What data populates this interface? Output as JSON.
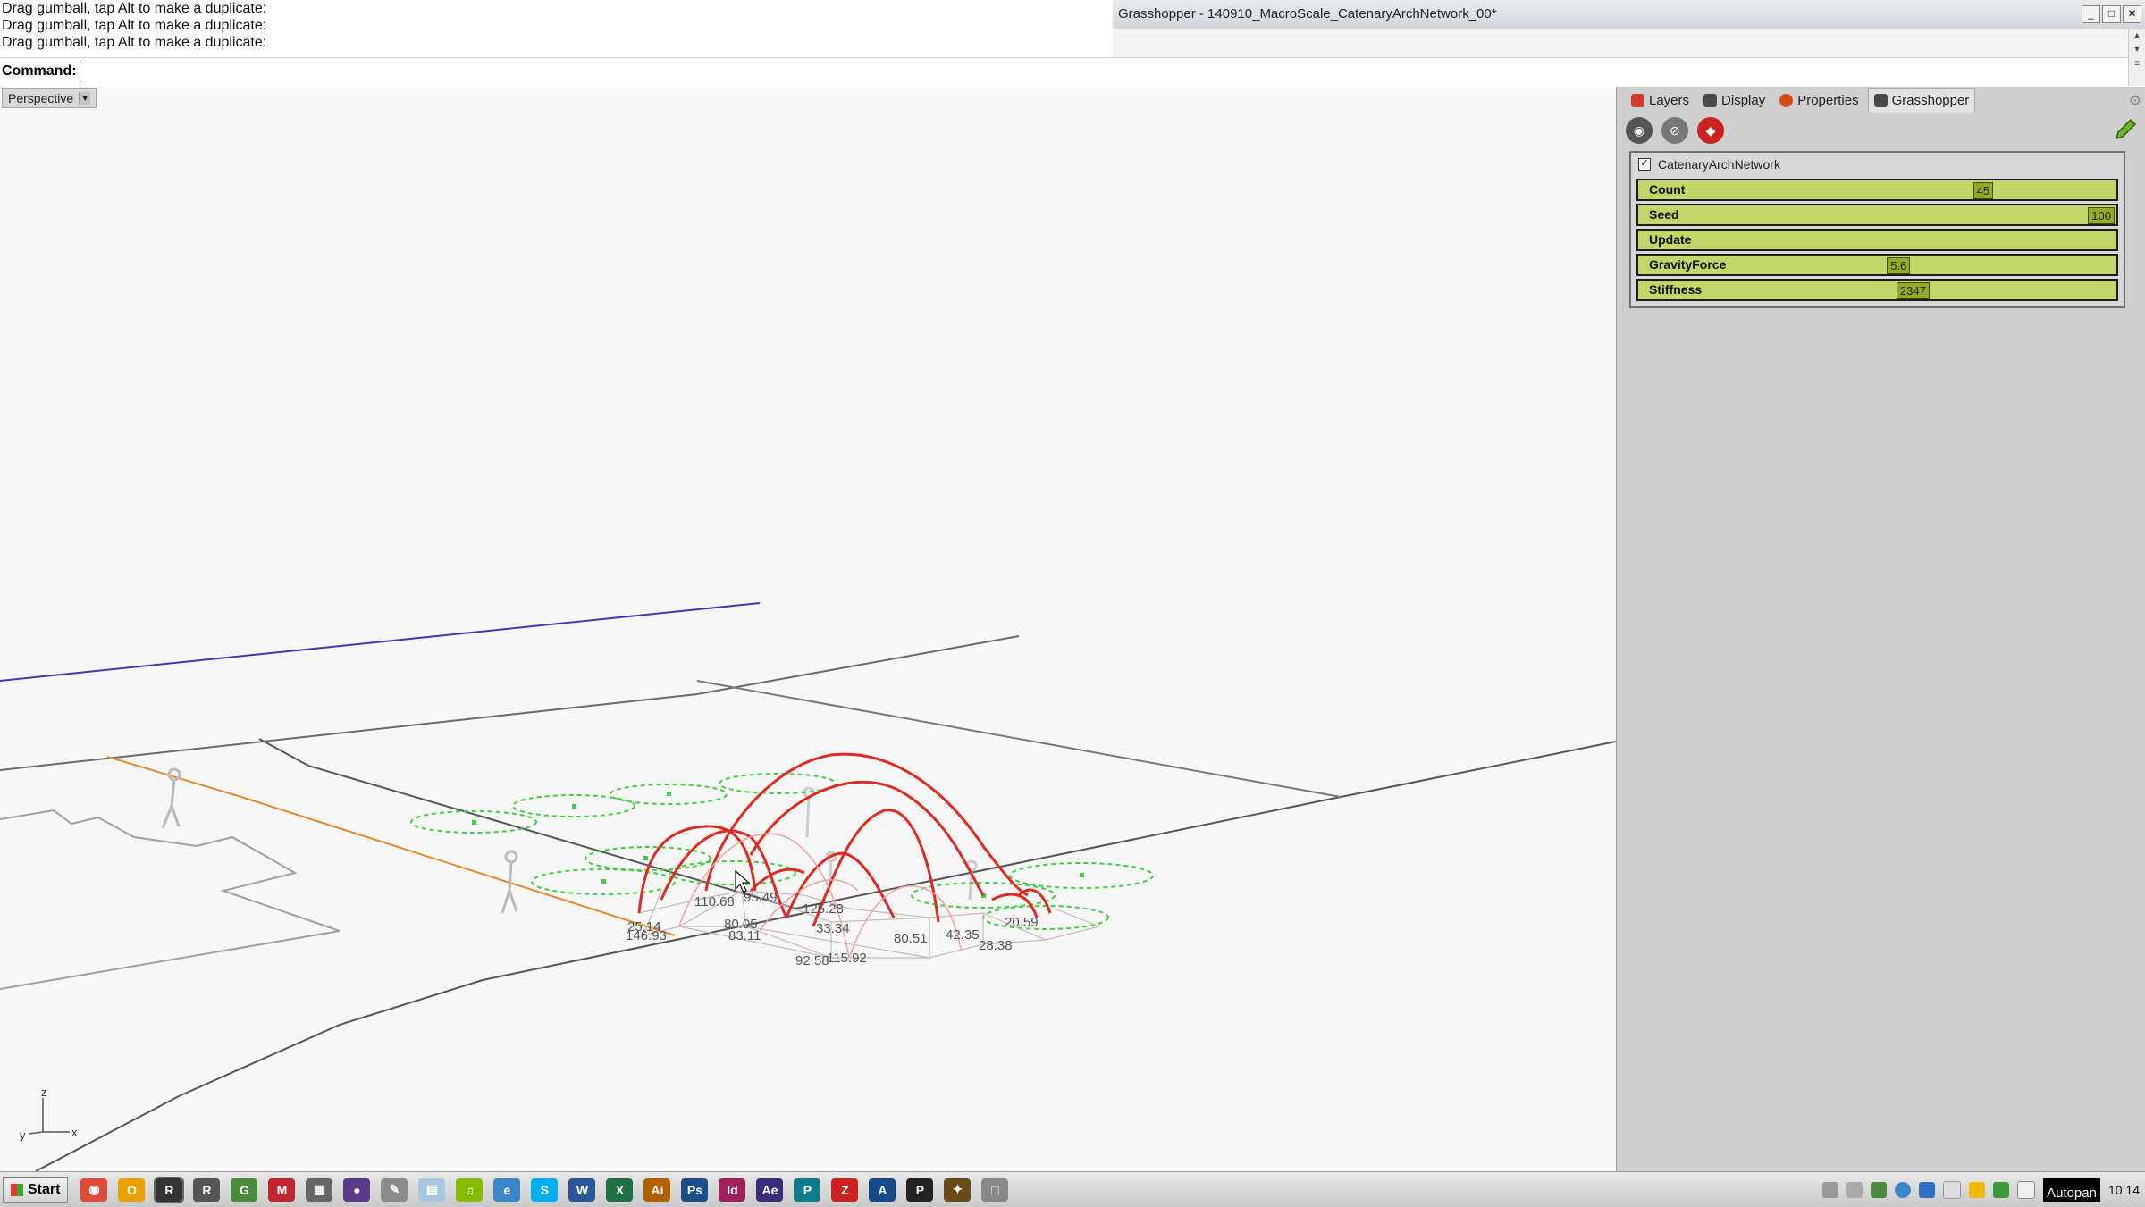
{
  "command_history": [
    "Drag gumball, tap Alt to make a duplicate:",
    "Drag gumball, tap Alt to make a duplicate:",
    "Drag gumball, tap Alt to make a duplicate:"
  ],
  "command_label": "Command:",
  "gh_window_title": "Grasshopper - 140910_MacroScale_CatenaryArchNetwork_00*",
  "window_buttons": {
    "min": "_",
    "max": "□",
    "close": "✕"
  },
  "viewport": {
    "label": "Perspective",
    "axes": {
      "z": "z",
      "y": "y",
      "x": "x"
    },
    "dimensions": [
      "110.68",
      "95.49",
      "80.05",
      "83.11",
      "146.93",
      "125.28",
      "33.34",
      "92.58",
      "115.92",
      "80.51",
      "42.35",
      "20.59",
      "28.38",
      "25.14"
    ]
  },
  "panel": {
    "tabs": [
      {
        "label": "Layers",
        "color": "#d23a2a"
      },
      {
        "label": "Display",
        "color": "#4a4a4a"
      },
      {
        "label": "Properties",
        "color": "#d44a1a"
      },
      {
        "label": "Grasshopper",
        "color": "#4a4a4a"
      }
    ],
    "group_title": "CatenaryArchNetwork",
    "sliders": [
      {
        "name": "Count",
        "value": "45",
        "fraction": 0.7
      },
      {
        "name": "Seed",
        "value": "100",
        "fraction": 0.94
      },
      {
        "name": "Update",
        "value": "",
        "fraction": null
      },
      {
        "name": "GravityForce",
        "value": "5.6",
        "fraction": 0.52
      },
      {
        "name": "Stiffness",
        "value": "2347",
        "fraction": 0.54
      }
    ]
  },
  "taskbar": {
    "start": "Start",
    "apps": [
      {
        "name": "chrome",
        "glyph": "◉",
        "color": "#dd4b39"
      },
      {
        "name": "outlook",
        "glyph": "O",
        "color": "#e8a200"
      },
      {
        "name": "rhino",
        "glyph": "R",
        "color": "#333333"
      },
      {
        "name": "rhino2",
        "glyph": "R",
        "color": "#555555"
      },
      {
        "name": "grasshopper",
        "glyph": "G",
        "color": "#4b8a3c"
      },
      {
        "name": "maxwell",
        "glyph": "M",
        "color": "#c0262d"
      },
      {
        "name": "calc",
        "glyph": "▦",
        "color": "#666666"
      },
      {
        "name": "media",
        "glyph": "●",
        "color": "#5b3a8c"
      },
      {
        "name": "paint",
        "glyph": "✎",
        "color": "#8a8a8a"
      },
      {
        "name": "explorer",
        "glyph": "▤",
        "color": "#a8c7e0"
      },
      {
        "name": "spotify",
        "glyph": "♫",
        "color": "#84bd00"
      },
      {
        "name": "ie",
        "glyph": "e",
        "color": "#3a86c8"
      },
      {
        "name": "skype",
        "glyph": "S",
        "color": "#00aff0"
      },
      {
        "name": "word",
        "glyph": "W",
        "color": "#2b5797"
      },
      {
        "name": "excel",
        "glyph": "X",
        "color": "#1e7145"
      },
      {
        "name": "illustrator",
        "glyph": "Ai",
        "color": "#b06000"
      },
      {
        "name": "photoshop",
        "glyph": "Ps",
        "color": "#1a4f8a"
      },
      {
        "name": "indesign",
        "glyph": "Id",
        "color": "#a0205e"
      },
      {
        "name": "aftereffects",
        "glyph": "Ae",
        "color": "#3c2d7a"
      },
      {
        "name": "publisher",
        "glyph": "P",
        "color": "#107b8a"
      },
      {
        "name": "filezilla",
        "glyph": "Z",
        "color": "#c22"
      },
      {
        "name": "acrobat",
        "glyph": "A",
        "color": "#174a8a"
      },
      {
        "name": "pdfapp",
        "glyph": "P",
        "color": "#222222"
      },
      {
        "name": "gh2",
        "glyph": "✦",
        "color": "#6b4a1a"
      },
      {
        "name": "window",
        "glyph": "□",
        "color": "#888888"
      }
    ],
    "tray_label": "Autopan",
    "clock": "10:14"
  }
}
